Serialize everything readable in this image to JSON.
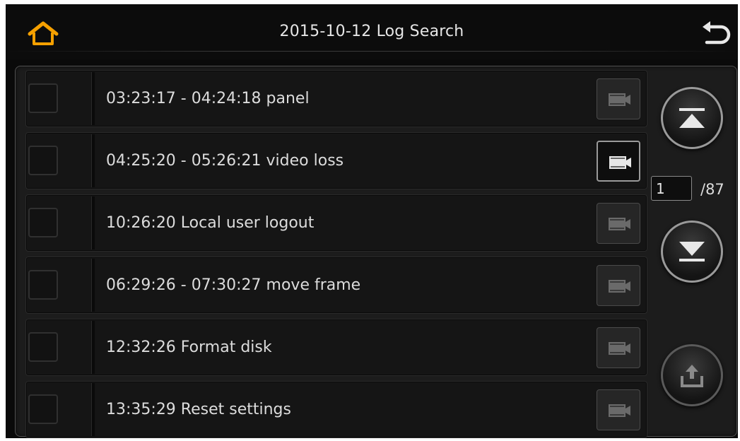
{
  "header": {
    "title": "2015-10-12  Log Search",
    "home_icon": "home-icon",
    "back_icon": "back-arrow-icon",
    "accent_color": "#f5a000"
  },
  "logs": [
    {
      "text": "03:23:17 - 04:24:18 panel",
      "play_active": false
    },
    {
      "text": "04:25:20 - 05:26:21 video loss",
      "play_active": true
    },
    {
      "text": "10:26:20  Local user logout",
      "play_active": false
    },
    {
      "text": "06:29:26 - 07:30:27 move frame",
      "play_active": false
    },
    {
      "text": "12:32:26  Format disk",
      "play_active": false
    },
    {
      "text": "13:35:29  Reset settings",
      "play_active": false
    }
  ],
  "pagination": {
    "current_page": "1",
    "total": "/87"
  },
  "side_buttons": {
    "page_up_icon": "page-up-icon",
    "page_down_icon": "page-down-icon",
    "export_icon": "export-icon"
  }
}
